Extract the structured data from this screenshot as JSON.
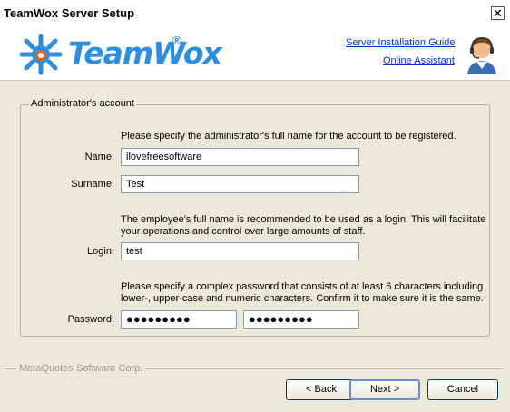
{
  "window": {
    "title": "TeamWox Server Setup",
    "close_glyph": "✕"
  },
  "header": {
    "logo_text": "TeamWox",
    "logo_reg": "®",
    "links": {
      "installation_guide": "Server Installation Guide",
      "online_assistant": "Online Assistant"
    },
    "colors": {
      "brand": "#2c8ee0",
      "logo_bug": "#e8601c"
    }
  },
  "form": {
    "group_title": "Administrator's account",
    "intro": "Please specify the administrator's full name for the account to be registered.",
    "name": {
      "label": "Name:",
      "value": "ilovefreesoftware"
    },
    "surname": {
      "label": "Surname:",
      "value": "Test"
    },
    "login_note_line1": "The employee's full name is recommended to be used as a login. This will facilitate",
    "login_note_line2": "your operations and control over large amounts of staff.",
    "login": {
      "label": "Login:",
      "value": "test"
    },
    "password_note_line1": "Please specify a complex password that consists of at least 6 characters including",
    "password_note_line2": "lower-, upper-case and numeric characters. Confirm it to make sure it is the same.",
    "password": {
      "label": "Password:",
      "value": "●●●●●●●●●",
      "confirm_value": "●●●●●●●●●"
    }
  },
  "footer": {
    "company": "MetaQuotes Software Corp."
  },
  "buttons": {
    "back": "< Back",
    "next": "Next >",
    "cancel": "Cancel"
  }
}
